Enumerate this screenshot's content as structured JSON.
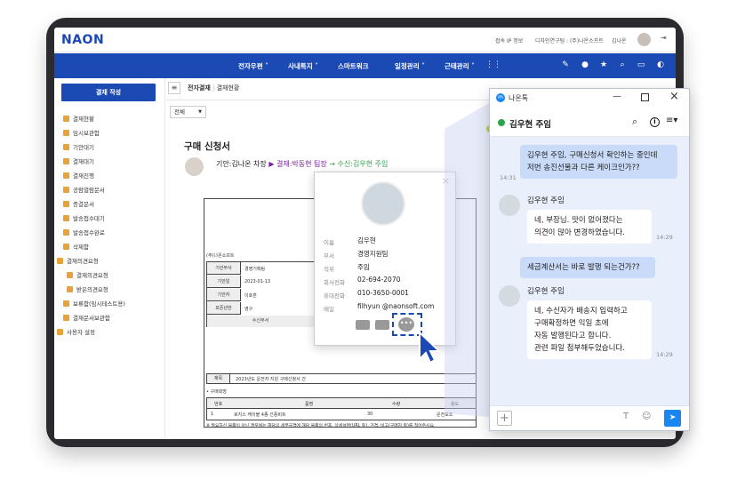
{
  "app": {
    "logo": "NAON"
  },
  "topbar": {
    "ip_info": "접속 IP 정보",
    "dept": "디자인연구팀 : (주)나온소프트",
    "user": "김나온"
  },
  "nav": {
    "items": [
      "전자우편 ˅",
      "사내톡지 ˅",
      "스마트워크",
      "일정관리 ˅",
      "근태관리 ˅"
    ]
  },
  "sidebar": {
    "compose": "결재 작성",
    "items": [
      "결재현황",
      "임시보관함",
      "기안대기",
      "결재대기",
      "결재진행",
      "공람열람문서",
      "종결문서",
      "발송접수대기",
      "발송접수완료",
      "삭제함",
      "결재의견요청",
      "결재의견요청",
      "받은의견요청",
      "보류함(임시테스트용)",
      "결재문서보관함",
      "사용자 설정"
    ]
  },
  "main": {
    "breadcrumb": [
      "전자결재",
      "결재현황"
    ],
    "filter": "전체",
    "doc_title": "구매 신청서",
    "approval_line": {
      "drafter": "기안:김나온 차장",
      "approver": "▶ 결재:박동현 팀장",
      "receiver": "→ 수신:김우현 주임"
    },
    "form": {
      "company": "(주)나온소프트",
      "doc_no": "3-0002",
      "rows": [
        [
          "기안부서",
          "경영기획팀"
        ],
        [
          "기안일",
          "2023-01-13"
        ],
        [
          "기안자",
          "이호훈"
        ],
        [
          "보존년한",
          "영구"
        ]
      ],
      "recv_dept_label": "수신부서",
      "subject_label": "제목",
      "subject": "2023년도 운전자 지원 구매신청서 건",
      "note_label": "• 구매희망",
      "table_headers": [
        "번호",
        "품명",
        "수량",
        "용도"
      ],
      "table_row": [
        "1",
        "로지스 케이블 4종 선풍비트",
        "30",
        "운전보조"
      ],
      "footnote": "※ 필요하신 물품이 아닌 경우에는 해당의 세부규격에 해당 물품의 번호, 상세설명(URL 등), 가격, 비고(구매처 등)를 적어주시요."
    }
  },
  "profile_popup": {
    "fields": [
      {
        "label": "이름",
        "value": "김우현"
      },
      {
        "label": "부서",
        "value": "경영지원팀"
      },
      {
        "label": "직위",
        "value": "주임"
      },
      {
        "label": "회사전화",
        "value": "02-694-2070"
      },
      {
        "label": "휴대전화",
        "value": "010-3650-0001"
      },
      {
        "label": "메일",
        "value": "filhyun @naonsoft.com"
      }
    ]
  },
  "chat": {
    "window_title": "나온톡",
    "room_name": "김우현 주임",
    "messages": [
      {
        "mine": true,
        "text": "김우현 주임, 구매신청서 확인하는 중인데\n저번 송진선물과 다른 케이크인가??",
        "time": "14:31"
      },
      {
        "mine": false,
        "sender": "김우현 주임",
        "text": "네, 부장님. 맛이 없어졌다는\n의견이 많아 변경하였습니다.",
        "time": "14:29"
      },
      {
        "mine": true,
        "text": "세금계산서는 바로 발행 되는건가??",
        "time": ""
      },
      {
        "mine": false,
        "sender": "김우현 주임",
        "text": "네, 수신자가 배송지 입력하고\n구매확정하면 익일 초에\n자동 발행된다고 합니다.\n관련 파일 첨부해두었습니다.",
        "time": "14:29"
      }
    ]
  },
  "colors": {
    "brand": "#1c4ab5",
    "accent_green": "#2aa34a",
    "chat_mine": "#c9dbf8",
    "chat_bg": "#e9effb"
  }
}
